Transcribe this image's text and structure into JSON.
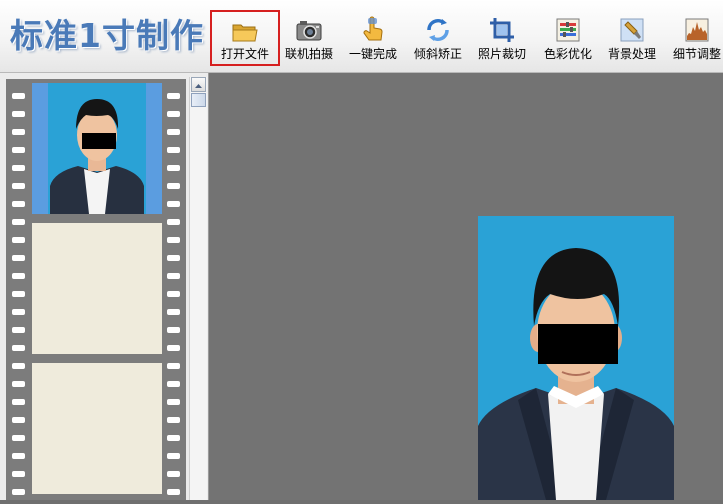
{
  "app": {
    "title": "标准1寸制作"
  },
  "toolbar": {
    "items": [
      {
        "label": "打开文件",
        "icon": "folder-icon",
        "active": true
      },
      {
        "label": "联机拍摄",
        "icon": "camera-icon"
      },
      {
        "label": "一键完成",
        "icon": "hand-pointer-icon"
      },
      {
        "label": "倾斜矫正",
        "icon": "rotate-arrows-icon"
      },
      {
        "label": "照片裁切",
        "icon": "crop-icon"
      },
      {
        "label": "色彩优化",
        "icon": "color-sliders-icon"
      },
      {
        "label": "背景处理",
        "icon": "brush-icon"
      },
      {
        "label": "细节调整",
        "icon": "histogram-icon"
      }
    ]
  },
  "colors": {
    "title_blue": "#4a7ab8",
    "active_border": "#d62020",
    "photo_bg_blue": "#2aa2d6",
    "thumb_bg_blue": "#5b9de0",
    "film_gray": "#7c7c7c",
    "frame_empty": "#efebdc",
    "workspace_gray": "#737373"
  }
}
